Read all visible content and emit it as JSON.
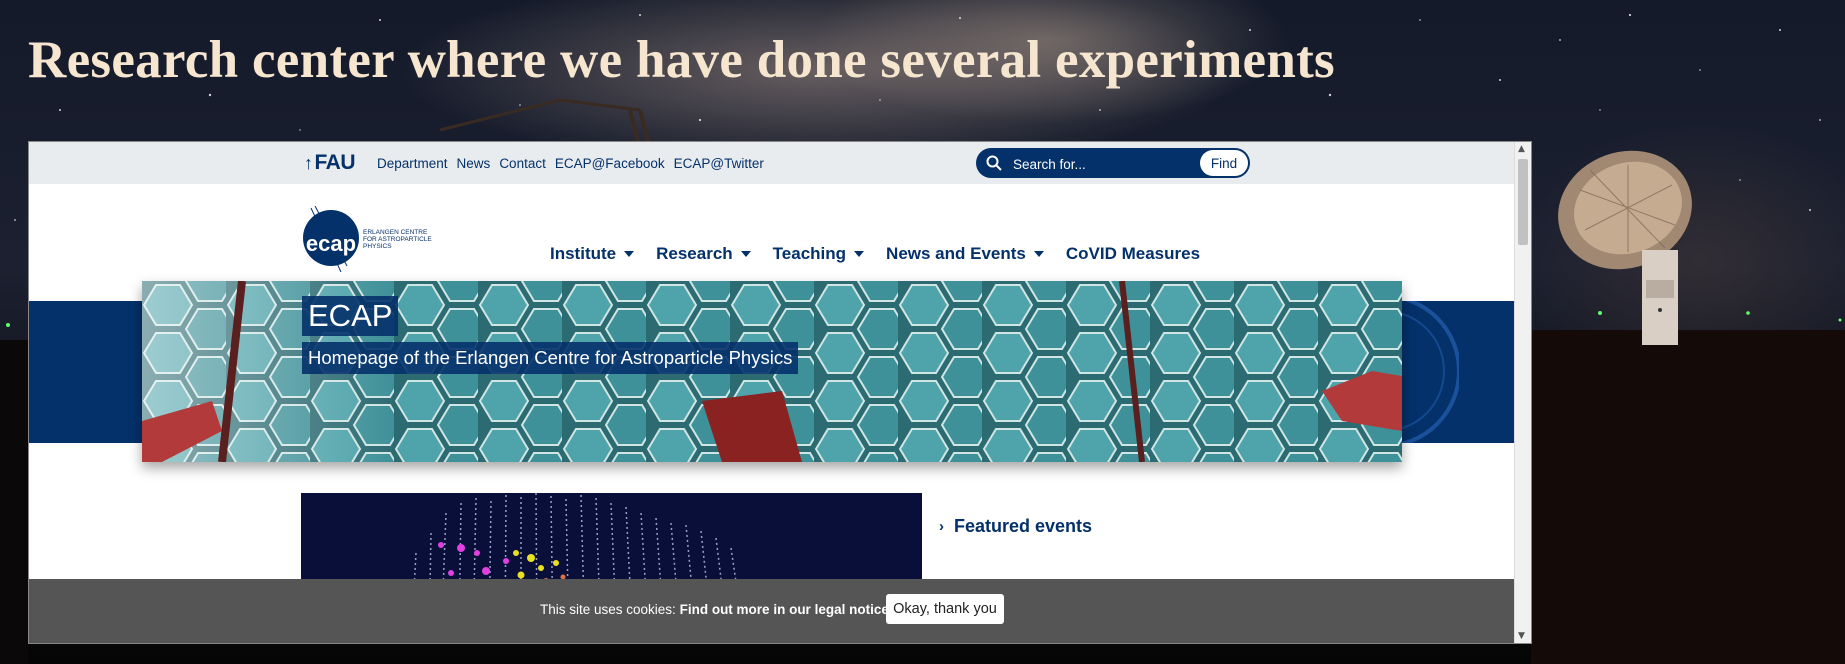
{
  "page": {
    "heading": "Research center where we have done several experiments"
  },
  "site": {
    "fau_logo": "FAU",
    "meta_links": [
      "Department",
      "News",
      "Contact",
      "ECAP@Facebook",
      "ECAP@Twitter"
    ],
    "search": {
      "placeholder": "Search for...",
      "button": "Find"
    },
    "logo_text": "ecap",
    "logo_caption": [
      "ERLANGEN CENTRE",
      "FOR ASTROPARTICLE",
      "PHYSICS"
    ],
    "nav": [
      {
        "label": "Institute",
        "dropdown": true
      },
      {
        "label": "Research",
        "dropdown": true
      },
      {
        "label": "Teaching",
        "dropdown": true
      },
      {
        "label": "News and Events",
        "dropdown": true
      },
      {
        "label": "CoVID Measures",
        "dropdown": false
      }
    ],
    "hero": {
      "title": "ECAP",
      "subtitle": "Homepage of the Erlangen Centre for Astroparticle Physics"
    },
    "featured": {
      "link": "Featured events"
    },
    "cookie": {
      "text": "This site uses cookies:",
      "link": "Find out more in our legal notice.",
      "button": "Okay, thank you"
    }
  },
  "colors": {
    "brand": "#04316a",
    "heading": "#f6e6cf",
    "cookie_bar": "#555555",
    "meta_bar": "#e9ecef"
  },
  "icons": [
    "search-icon",
    "chevron-right-icon",
    "chevron-down-icon",
    "fau-arrow-icon"
  ]
}
